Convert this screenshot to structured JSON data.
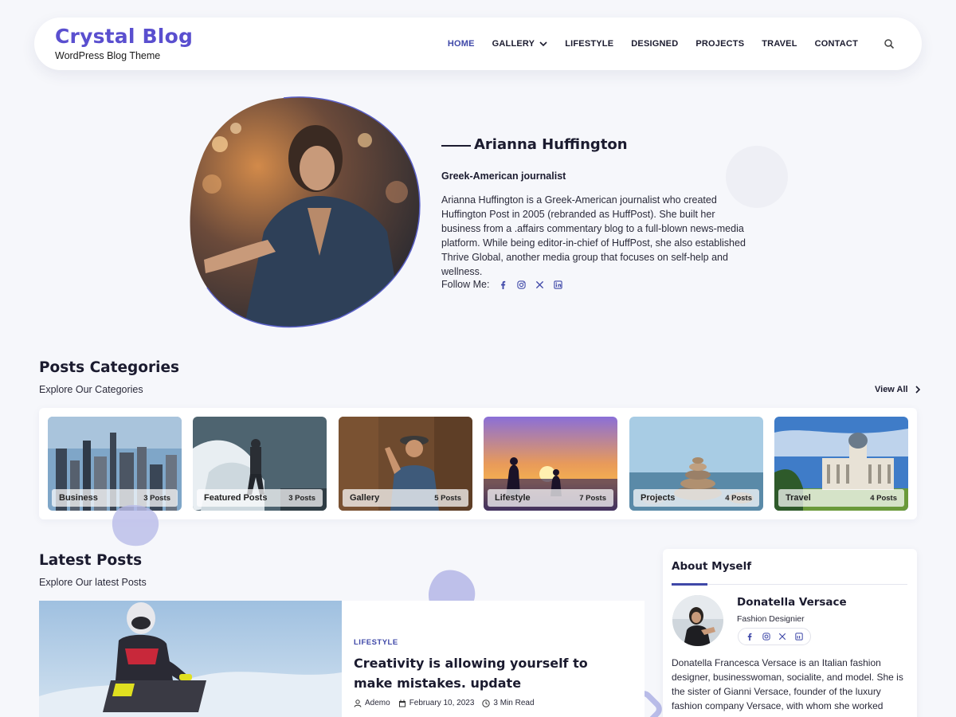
{
  "header": {
    "brand_title": "Crystal Blog",
    "brand_subtitle": "WordPress Blog Theme",
    "nav": [
      {
        "label": "HOME",
        "active": true
      },
      {
        "label": "GALLERY",
        "has_dropdown": true
      },
      {
        "label": "LIFESTYLE"
      },
      {
        "label": "DESIGNED"
      },
      {
        "label": "PROJECTS"
      },
      {
        "label": "TRAVEL"
      },
      {
        "label": "CONTACT"
      }
    ],
    "search_icon": "search-icon"
  },
  "hero": {
    "name": "Arianna Huffington",
    "role": "Greek-American journalist",
    "bio": "Arianna Huffington is a Greek-American journalist who created Huffington Post in 2005 (rebranded as HuffPost). She built her business from a .affairs commentary blog to a full-blown news-media platform. While being editor-in-chief of HuffPost, she also established Thrive Global, another media group that focuses on self-help and wellness.",
    "follow_label": "Follow Me:",
    "socials": [
      "facebook-icon",
      "instagram-icon",
      "x-icon",
      "linkedin-icon"
    ]
  },
  "categories": {
    "title": "Posts Categories",
    "subtitle": "Explore Our Categories",
    "view_all": "View All",
    "items": [
      {
        "name": "Business",
        "count": "3 Posts"
      },
      {
        "name": "Featured Posts",
        "count": "3 Posts"
      },
      {
        "name": "Gallery",
        "count": "5 Posts"
      },
      {
        "name": "Lifestyle",
        "count": "7 Posts"
      },
      {
        "name": "Projects",
        "count": "4 Posts"
      },
      {
        "name": "Travel",
        "count": "4 Posts"
      }
    ]
  },
  "latest": {
    "title": "Latest Posts",
    "subtitle": "Explore Our latest Posts",
    "post": {
      "tag": "LIFESTYLE",
      "title": "Creativity is allowing yourself to make mistakes. update",
      "author": "Ademo",
      "date": "February 10, 2023",
      "read_time": "3 Min Read"
    }
  },
  "about": {
    "title": "About Myself",
    "name": "Donatella Versace",
    "role": "Fashion Designier",
    "bio": "Donatella Francesca Versace is an Italian fashion designer, businesswoman, socialite, and model. She is the sister of Gianni Versace, founder of the luxury fashion company Versace, with whom she worked",
    "socials": [
      "facebook-icon",
      "instagram-icon",
      "x-icon",
      "linkedin-icon"
    ]
  },
  "colors": {
    "brand": "#5a4fcf",
    "accent": "#3f48a8",
    "background": "#f6f7fb",
    "text": "#1b1b2f"
  }
}
